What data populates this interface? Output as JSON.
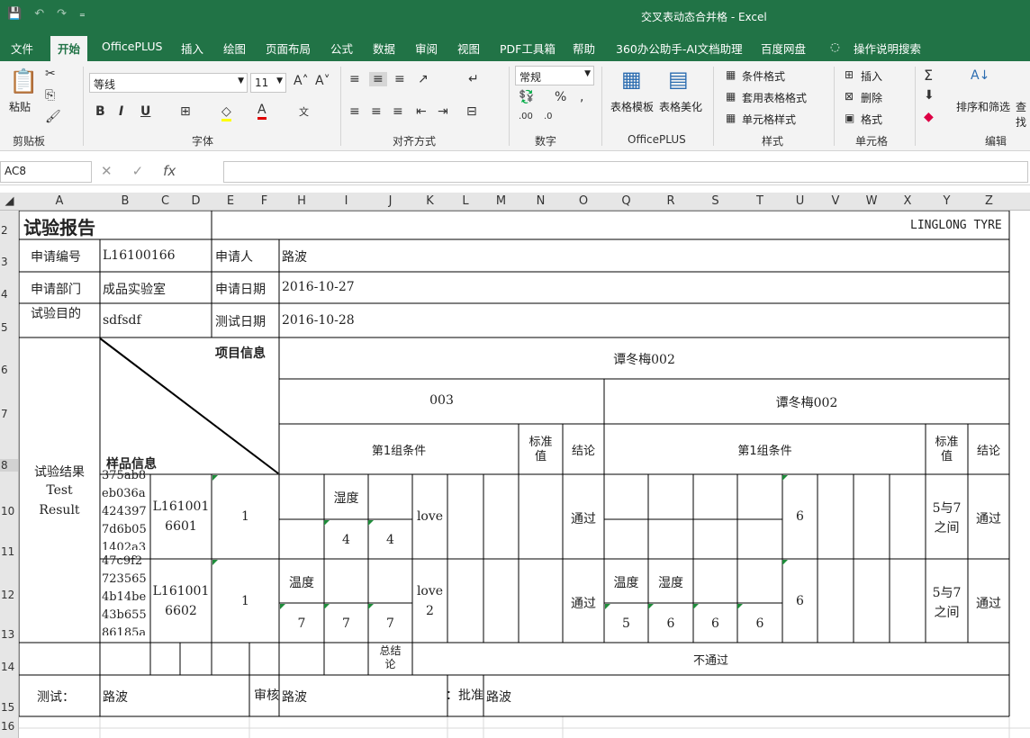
{
  "window": {
    "title": "交叉表动态合并格  -  Excel"
  },
  "qat": {
    "save": "💾",
    "undo": "↶",
    "redo": "↷",
    "more": "₌"
  },
  "menu": {
    "tabs": [
      "文件",
      "开始",
      "OfficePLUS",
      "插入",
      "绘图",
      "页面布局",
      "公式",
      "数据",
      "审阅",
      "视图",
      "PDF工具箱",
      "帮助",
      "360办公助手-AI文档助理",
      "百度网盘"
    ],
    "tell": "操作说明搜索"
  },
  "ribbon": {
    "paste": "粘贴",
    "clipboard": "剪贴板",
    "font_name": "等线",
    "font_size": "11",
    "font_group": "字体",
    "bold": "B",
    "italic": "I",
    "underline": "U",
    "align_group": "对齐方式",
    "number_format": "常规",
    "number_group": "数字",
    "table_template": "表格模板",
    "table_beautify": "表格美化",
    "officeplus_group": "OfficePLUS",
    "cond_format": "条件格式",
    "table_format": "套用表格格式",
    "cell_style": "单元格样式",
    "style_group": "样式",
    "insert": "插入",
    "delete": "删除",
    "format": "格式",
    "cells_group": "单元格",
    "sort_filter": "排序和筛选",
    "find": "查找",
    "edit_group": "编辑"
  },
  "formula_bar": {
    "name_box": "AC8",
    "fx": "fx",
    "value": ""
  },
  "columns": [
    "A",
    "B",
    "C",
    "D",
    "E",
    "F",
    "H",
    "I",
    "J",
    "K",
    "L",
    "M",
    "N",
    "O",
    "Q",
    "R",
    "S",
    "T",
    "U",
    "V",
    "W",
    "X",
    "Y",
    "Z"
  ],
  "rows": [
    "2",
    "3",
    "4",
    "5",
    "6",
    "7",
    "8",
    "10",
    "11",
    "12",
    "13",
    "14",
    "15",
    "16"
  ],
  "report": {
    "title": "试验报告",
    "brand": "LINGLONG TYRE",
    "app_no_label": "申请编号",
    "app_no": "L16100166",
    "applicant_label": "申请人",
    "applicant": "路波",
    "dept_label": "申请部门",
    "dept": "成品实验室",
    "app_date_label": "申请日期",
    "app_date": "2016-10-27",
    "purpose_label": "试验目的",
    "purpose": "sdfsdf",
    "test_date_label": "测试日期",
    "test_date": "2016-10-28",
    "result_label_cn": "试验结果",
    "result_label_en1": "Test",
    "result_label_en2": "Result",
    "project_info": "项目信息",
    "sample_info": "样品信息",
    "top_header": "谭冬梅002",
    "group_left": "003",
    "group_right": "谭冬梅002",
    "cond_left": "第1组条件",
    "std_left": "标准值",
    "concl_left": "结论",
    "cond_right": "第1组条件",
    "std_right": "标准值",
    "concl_right": "结论",
    "sample1": {
      "id_lines": [
        "375ab8",
        "eb036a",
        "424397",
        "7d6b05",
        "1402a3"
      ],
      "code": [
        "L161001",
        "6601"
      ],
      "qty": "1",
      "humid": "湿度",
      "v1": "4",
      "v2": "4",
      "k": "love",
      "concl_l": "通过",
      "u": "6",
      "std_r": [
        "5与7",
        "之间"
      ],
      "concl_r": "通过"
    },
    "sample2": {
      "id_lines": [
        "47c9f2",
        "723565",
        "4b14be",
        "43b655",
        "86185a"
      ],
      "code": [
        "L161001",
        "6602"
      ],
      "qty": "1",
      "temp": "温度",
      "v1": "7",
      "v2": "7",
      "v3": "7",
      "k": [
        "love",
        "2"
      ],
      "concl_l": "通过",
      "temp_r": "温度",
      "humid_r": "湿度",
      "r1": "5",
      "r2": "6",
      "r3": "6",
      "r4": "6",
      "u": "6",
      "std_r": [
        "5与7",
        "之间"
      ],
      "concl_r": "通过"
    },
    "summary_label": [
      "总结",
      "论"
    ],
    "summary": "不通过",
    "tester_label": "测试：",
    "tester": "路波",
    "reviewer_label": "审核：",
    "reviewer": "路波",
    "approver_label": "批准：",
    "approver": "路波"
  }
}
